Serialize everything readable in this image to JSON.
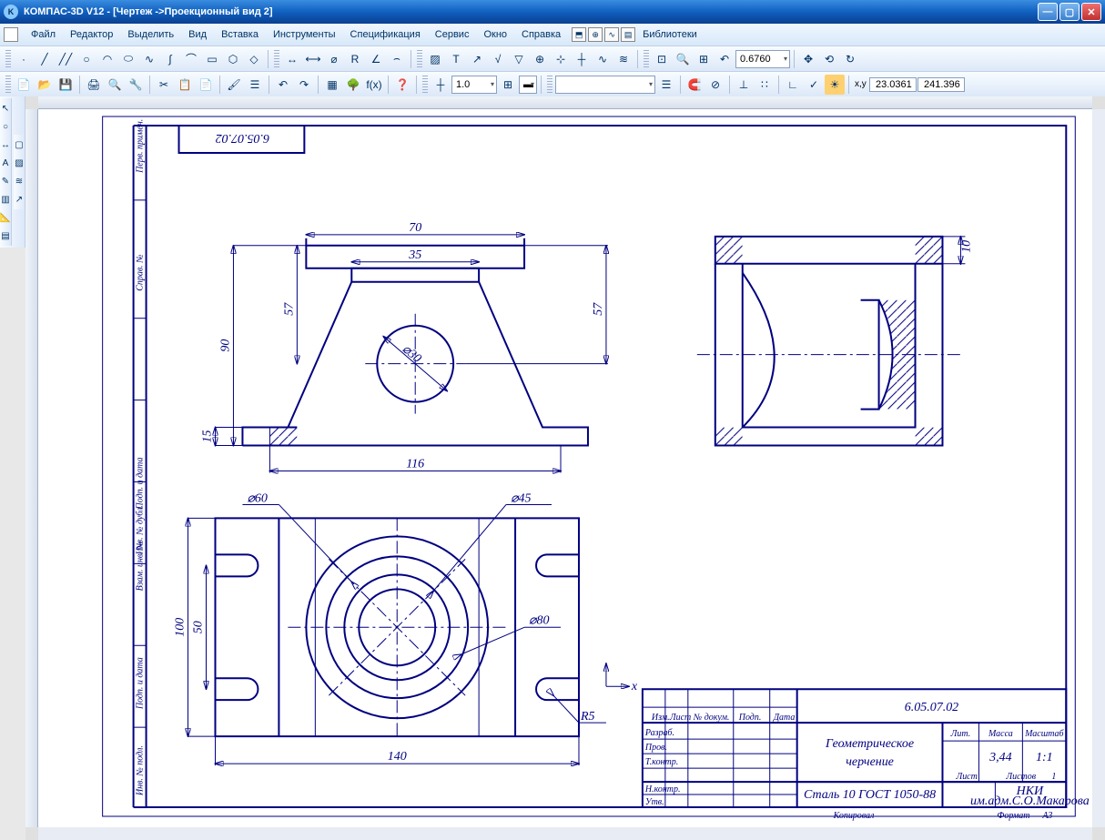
{
  "title": "КОМПАС-3D V12 - [Чертеж ->Проекционный вид 2]",
  "menu": [
    "Файл",
    "Редактор",
    "Выделить",
    "Вид",
    "Вставка",
    "Инструменты",
    "Спецификация",
    "Сервис",
    "Окно",
    "Справка",
    "Библиотеки"
  ],
  "zoom_value": "0.6760",
  "step_value": "1.0",
  "coord_x": "23.0361",
  "coord_y": "241.396",
  "drawing": {
    "number": "6.05.07.02",
    "number_mirror": "6.05.07.02",
    "title_line1": "Геометрическое",
    "title_line2": "черчение",
    "material": "Сталь 10  ГОСТ 1050-88",
    "inst1": "НКИ",
    "inst2": "им.адм.С.О.Макарова",
    "mass": "3,44",
    "scale": "1:1",
    "sheets": "1",
    "sheet": "",
    "format": "А3",
    "dims": {
      "d70": "70",
      "d35": "35",
      "d57a": "57",
      "d90": "90",
      "d15": "15",
      "d116": "116",
      "d57b": "57",
      "d30": "⌀30",
      "d10": "10",
      "d60": "⌀60",
      "d45": "⌀45",
      "d80": "⌀80",
      "d100": "100",
      "d50": "50",
      "d140": "140",
      "r5": "R5"
    },
    "rows": [
      "Разраб.",
      "Пров.",
      "Т.контр.",
      "",
      "Н.контр.",
      "Утв."
    ],
    "cols": {
      "izm": "Изм.",
      "list": "Лист",
      "ndok": "№ докум.",
      "podp": "Подп.",
      "data": "Дата",
      "lit": "Лит.",
      "massa": "Масса",
      "masht": "Масштаб",
      "list2": "Лист",
      "listov": "Листов",
      "kopir": "Копировал",
      "format": "Формат"
    },
    "side_rows": [
      "Перв. примен.",
      "Справ. №",
      "Подп. и дата",
      "Взам. инв. №",
      "Инв. № дубл.",
      "Подп. и дата",
      "Инв. № подл."
    ]
  }
}
